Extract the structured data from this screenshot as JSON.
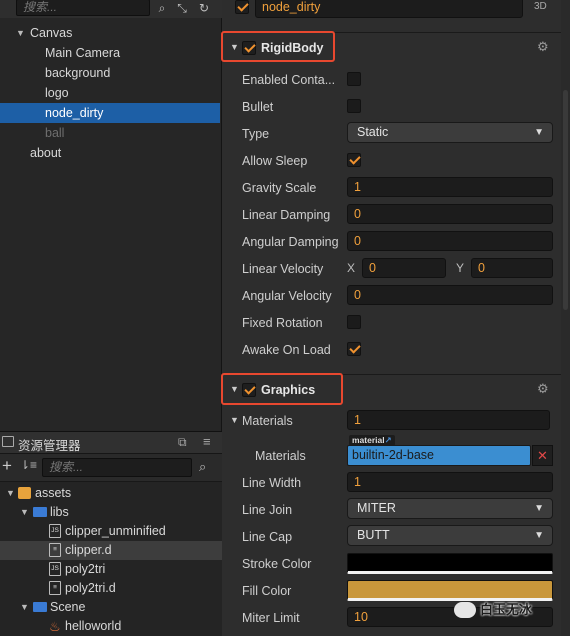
{
  "hierarchy": {
    "search_placeholder": "搜索...",
    "items": [
      {
        "label": "Canvas"
      },
      {
        "label": "Main Camera"
      },
      {
        "label": "background"
      },
      {
        "label": "logo"
      },
      {
        "label": "node_dirty"
      },
      {
        "label": "ball"
      },
      {
        "label": "about"
      }
    ]
  },
  "assets_panel": {
    "title": "资源管理器",
    "search_placeholder": "搜索...",
    "items": [
      {
        "label": "assets",
        "icon": "assets-folder-icon"
      },
      {
        "label": "libs",
        "icon": "folder-icon"
      },
      {
        "label": "clipper_unminified",
        "icon": "js-file-icon"
      },
      {
        "label": "clipper.d",
        "icon": "file-icon"
      },
      {
        "label": "poly2tri",
        "icon": "js-file-icon"
      },
      {
        "label": "poly2tri.d",
        "icon": "file-icon"
      },
      {
        "label": "Scene",
        "icon": "folder-icon"
      },
      {
        "label": "helloworld",
        "icon": "scene-icon"
      }
    ]
  },
  "inspector": {
    "node_name": "node_dirty",
    "mode_label": "3D",
    "rigidbody": {
      "title": "RigidBody",
      "enabled_contact_label": "Enabled Conta...",
      "enabled_contact": false,
      "bullet_label": "Bullet",
      "bullet": false,
      "type_label": "Type",
      "type_value": "Static",
      "allow_sleep_label": "Allow Sleep",
      "allow_sleep": true,
      "gravity_scale_label": "Gravity Scale",
      "gravity_scale": "1",
      "linear_damping_label": "Linear Damping",
      "linear_damping": "0",
      "angular_damping_label": "Angular Damping",
      "angular_damping": "0",
      "linear_velocity_label": "Linear Velocity",
      "linear_velocity_x_label": "X",
      "linear_velocity_x": "0",
      "linear_velocity_y_label": "Y",
      "linear_velocity_y": "0",
      "angular_velocity_label": "Angular Velocity",
      "angular_velocity": "0",
      "fixed_rotation_label": "Fixed Rotation",
      "fixed_rotation": false,
      "awake_on_load_label": "Awake On Load",
      "awake_on_load": true
    },
    "graphics": {
      "title": "Graphics",
      "materials_label": "Materials",
      "materials_count": "1",
      "material_tag": "material",
      "material_item_label": "Materials",
      "material_value": "builtin-2d-base",
      "line_width_label": "Line Width",
      "line_width": "1",
      "line_join_label": "Line Join",
      "line_join": "MITER",
      "line_cap_label": "Line Cap",
      "line_cap": "BUTT",
      "stroke_color_label": "Stroke Color",
      "stroke_color": "#000000",
      "fill_color_label": "Fill Color",
      "fill_color": "#c9973b",
      "miter_limit_label": "Miter Limit",
      "miter_limit": "10"
    }
  },
  "watermark": "白玉无冰",
  "colors": {
    "accent": "#f0922f",
    "selection": "#1d5fa6",
    "highlight_box": "#e8482f"
  }
}
